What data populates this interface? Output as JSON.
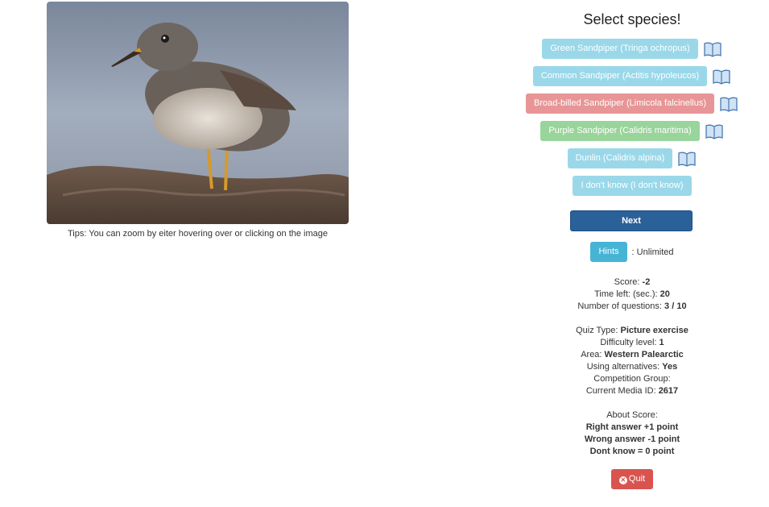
{
  "tips": "Tips: You can zoom by eiter hovering over or clicking on the image",
  "title": "Select species!",
  "answers": [
    {
      "label": "Green Sandpiper (Tringa ochropus)",
      "style": "info"
    },
    {
      "label": "Common Sandpiper (Actitis hypoleucos)",
      "style": "info"
    },
    {
      "label": "Broad-billed Sandpiper (Limicola falcinellus)",
      "style": "danger"
    },
    {
      "label": "Purple Sandpiper (Calidris maritima)",
      "style": "success"
    },
    {
      "label": "Dunlin (Calidris alpina)",
      "style": "info"
    },
    {
      "label": "I don't know (I don't know)",
      "style": "info"
    }
  ],
  "next_label": "Next",
  "hints": {
    "button": "Hints",
    "value": ": Unlimited"
  },
  "stats": {
    "score_label": "Score: ",
    "score": "-2",
    "time_label": "Time left: (sec.): ",
    "time": "20",
    "questions_label": "Number of questions: ",
    "questions": "3 / 10",
    "quiz_type_label": "Quiz Type: ",
    "quiz_type": "Picture exercise",
    "difficulty_label": "Difficulty level: ",
    "difficulty": "1",
    "area_label": "Area: ",
    "area": "Western Palearctic",
    "alternatives_label": "Using alternatives: ",
    "alternatives": "Yes",
    "competition_label": "Competition Group:",
    "media_label": "Current Media ID: ",
    "media": "2617"
  },
  "about": {
    "title": "About Score:",
    "right": "Right answer +1 point",
    "wrong": "Wrong answer -1 point",
    "dont": "Dont know = 0 point"
  },
  "quit_label": "Quit",
  "colors": {
    "info": "#9ad8e9",
    "danger": "#e79596",
    "success": "#99d49b",
    "primary": "#2b6199",
    "hints": "#46b4d5",
    "quit": "#d9534f"
  }
}
